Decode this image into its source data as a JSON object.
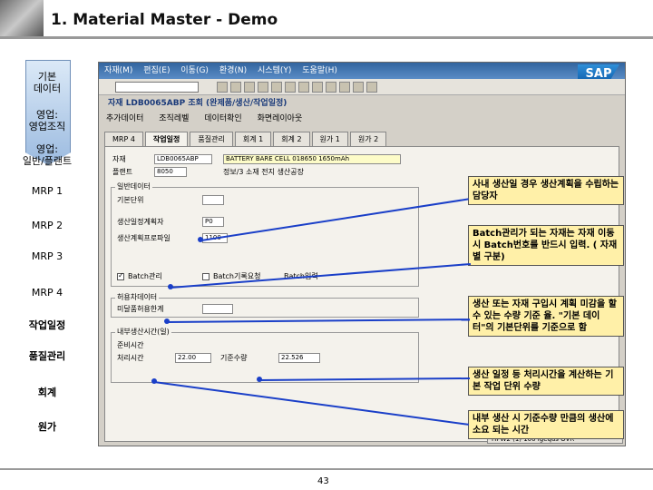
{
  "header": {
    "title": "1. Material Master - Demo"
  },
  "nav": [
    {
      "label": "기본\n데이터",
      "id": "nav-basic-data"
    },
    {
      "label": "영업:\n영업조직",
      "id": "nav-sales-org"
    },
    {
      "label": "영업:\n일반/플랜트",
      "id": "nav-sales-general"
    },
    {
      "label": "MRP 1",
      "id": "nav-mrp1"
    },
    {
      "label": "MRP 2",
      "id": "nav-mrp2"
    },
    {
      "label": "MRP 3",
      "id": "nav-mrp3"
    },
    {
      "label": "MRP 4",
      "id": "nav-mrp4"
    },
    {
      "label": "작업일정",
      "id": "nav-work-scheduling"
    },
    {
      "label": "품질관리",
      "id": "nav-quality"
    },
    {
      "label": "회계",
      "id": "nav-accounting"
    },
    {
      "label": "원가",
      "id": "nav-costing"
    }
  ],
  "sap": {
    "menu": [
      "자재(M)",
      "편집(E)",
      "이동(G)",
      "환경(N)",
      "시스템(Y)",
      "도움말(H)"
    ],
    "title": "자재 LDB0065ABP 조회 (완제품/생산/작업일정)",
    "app_toolbar": [
      "추가데이터",
      "조직레벨",
      "데이터확인",
      "화면레이아웃"
    ],
    "tabs": [
      "MRP 4",
      "작업일정",
      "품질관리",
      "회계 1",
      "회계 2",
      "원가 1",
      "원가 2"
    ],
    "material_label": "자재",
    "material_value": "LDB0065ABP",
    "material_desc": "BATTERY BARE CELL 018650 1650mAh",
    "plant_label": "플랜트",
    "plant_value": "8050",
    "plant_desc": "정보/3 소재 전지 생산공장",
    "general_group": "일반데이터",
    "fields": {
      "base_unit_label": "기본단위",
      "prod_scheduler_label": "생산일정계획자",
      "prod_scheduler_value": "P0",
      "prod_profile_label": "생산계획프로파일",
      "prod_profile_value": "1100",
      "batch_label": "Batch관리",
      "batch_record_label": "Batch기록요청",
      "batch_entry_label": "Batch입력"
    },
    "tolerance_group": "허용차데이터",
    "tolerance_label": "미달품허용한계",
    "inhouse_group": "내부생산시간(일)",
    "setup_label": "준비시간",
    "processing_label": "처리시간",
    "base_qty_label": "기준수량",
    "setup_value": "22.00",
    "base_qty_value": "22.526",
    "status_text": "HPW2 (1) 100  lgeqas  OVR"
  },
  "callouts": [
    {
      "text": "사내 생산일 경우 생산계획을 수립하는 담당자"
    },
    {
      "text": "Batch관리가 되는 자재는 자재 이동 시 Batch번호를 반드시 입력. ( 자재 별 구분)"
    },
    {
      "text": "생산 또는 자재 구입시 계획 미감을 할 수 있는 수량 기준 율. \"기본 데이터\"의 기본단위를 기준으로 함"
    },
    {
      "text": "생산 일정 등 처리시간을 계산하는 기본 작업 단위 수량"
    },
    {
      "text": "내부 생산 시 기준수량 만큼의 생산에 소요 되는 시간"
    }
  ],
  "footer": {
    "page": "43"
  },
  "colors": {
    "callout_bg": "#fff0a8",
    "line": "#1a3fc8",
    "sap_blue": "#32659f"
  }
}
